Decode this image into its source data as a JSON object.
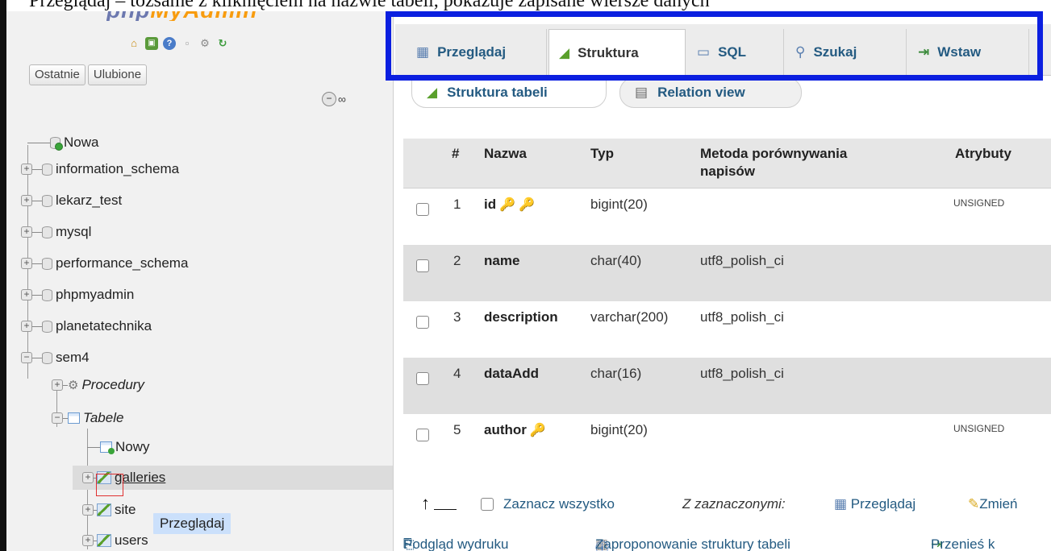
{
  "caption": "Przeglądaj – tożsame z kliknięciem na nazwie tabeli, pokazuje zapisane wiersze danych",
  "colors": {
    "accent": "#235a81",
    "highlight_frame": "#0b1fe0",
    "marker": "#e03030"
  },
  "nav": {
    "logo_a": "php",
    "logo_b": "MyAdmin",
    "icons": [
      "home-icon",
      "exit-icon",
      "help-icon",
      "docs-icon",
      "settings-icon",
      "reload-icon"
    ],
    "quick": {
      "recent": "Ostatnie",
      "favorites": "Ulubione"
    },
    "tree": {
      "new": "Nowa",
      "databases": [
        "information_schema",
        "lekarz_test",
        "mysql",
        "performance_schema",
        "phpmyadmin",
        "planetatechnika",
        "sem4"
      ],
      "procedures": "Procedury",
      "tables": "Tabele",
      "new_table": "Nowy",
      "table_items": [
        "galleries",
        "site",
        "users"
      ]
    },
    "tooltip": "Przeglądaj"
  },
  "tabs": [
    {
      "label": "Przeglądaj",
      "icon": "browse-icon"
    },
    {
      "label": "Struktura",
      "icon": "structure-icon"
    },
    {
      "label": "SQL",
      "icon": "sql-icon"
    },
    {
      "label": "Szukaj",
      "icon": "search-icon"
    },
    {
      "label": "Wstaw",
      "icon": "insert-icon"
    }
  ],
  "subtabs": {
    "structure": "Struktura tabeli",
    "relation": "Relation view"
  },
  "table": {
    "headers": {
      "num": "#",
      "name": "Nazwa",
      "type": "Typ",
      "collation": "Metoda porównywania napisów",
      "attributes": "Atrybuty"
    },
    "rows": [
      {
        "num": "1",
        "name": "id",
        "type": "bigint(20)",
        "collation": "",
        "attributes": "UNSIGNED"
      },
      {
        "num": "2",
        "name": "name",
        "type": "char(40)",
        "collation": "utf8_polish_ci",
        "attributes": ""
      },
      {
        "num": "3",
        "name": "description",
        "type": "varchar(200)",
        "collation": "utf8_polish_ci",
        "attributes": ""
      },
      {
        "num": "4",
        "name": "dataAdd",
        "type": "char(16)",
        "collation": "utf8_polish_ci",
        "attributes": ""
      },
      {
        "num": "5",
        "name": "author",
        "type": "bigint(20)",
        "collation": "",
        "attributes": "UNSIGNED"
      }
    ]
  },
  "footer": {
    "select_all": "Zaznacz wszystko",
    "with_selected": "Z zaznaczonymi:",
    "browse": "Przeglądaj",
    "change": "Zmień"
  },
  "bottom_links": [
    "Podgląd wydruku",
    "Zaproponowanie struktury tabeli",
    "Przenieś k"
  ]
}
